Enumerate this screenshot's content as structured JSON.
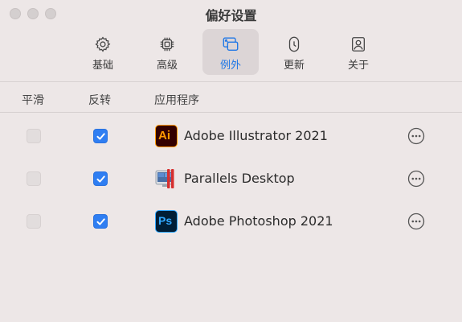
{
  "window": {
    "title": "偏好设置"
  },
  "toolbar": {
    "items": [
      {
        "label": "基础",
        "icon": "gear-icon"
      },
      {
        "label": "高级",
        "icon": "chip-icon"
      },
      {
        "label": "例外",
        "icon": "exception-window-icon",
        "active": true
      },
      {
        "label": "更新",
        "icon": "update-icon"
      },
      {
        "label": "关于",
        "icon": "about-icon"
      }
    ]
  },
  "table": {
    "columns": [
      "平滑",
      "反转",
      "应用程序"
    ],
    "rows": [
      {
        "smooth": false,
        "reverse": true,
        "app": "Adobe Illustrator 2021",
        "icon": "illustrator-icon",
        "icon_text": "Ai"
      },
      {
        "smooth": false,
        "reverse": true,
        "app": "Parallels Desktop",
        "icon": "parallels-icon"
      },
      {
        "smooth": false,
        "reverse": true,
        "app": "Adobe Photoshop 2021",
        "icon": "photoshop-icon",
        "icon_text": "Ps"
      }
    ]
  },
  "colors": {
    "accent": "#2f7ef2",
    "background": "#ede7e7",
    "active_tab_bg": "#dcd5d6",
    "illustrator_bg": "#330000",
    "illustrator_fg": "#ff9a00",
    "photoshop_bg": "#001e36",
    "photoshop_fg": "#31a8ff"
  }
}
